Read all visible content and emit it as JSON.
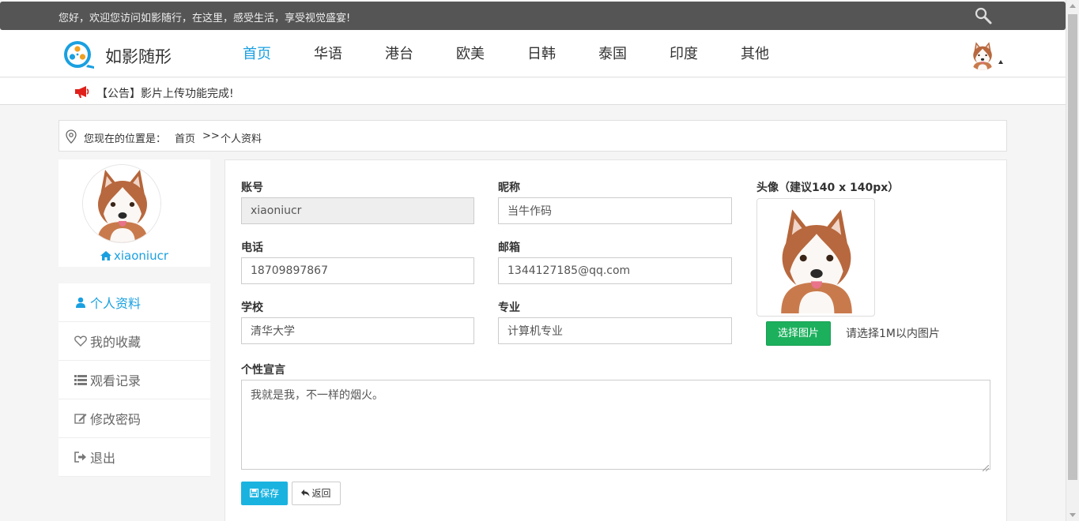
{
  "topbar": {
    "welcome": "您好，欢迎您访问如影随行，在这里，感受生活，享受视觉盛宴!",
    "search_icon": "search-icon"
  },
  "header": {
    "brand": "如影随形",
    "nav": [
      "首页",
      "华语",
      "港台",
      "欧美",
      "日韩",
      "泰国",
      "印度",
      "其他"
    ],
    "active_nav": "首页",
    "accent_color": "#1aa0e0"
  },
  "notice": {
    "text": "【公告】影片上传功能完成!",
    "icon": "megaphone-icon",
    "icon_color": "#e0201a"
  },
  "breadcrumb": {
    "label": "您现在的位置是：",
    "home": "首页",
    "separator": ">>",
    "current": "个人资料"
  },
  "profile": {
    "username": "xiaoniucr"
  },
  "menu": [
    {
      "label": "个人资料",
      "icon": "user-icon"
    },
    {
      "label": "我的收藏",
      "icon": "heart-icon"
    },
    {
      "label": "观看记录",
      "icon": "list-icon"
    },
    {
      "label": "修改密码",
      "icon": "edit-icon"
    },
    {
      "label": "退出",
      "icon": "sign-out-icon"
    }
  ],
  "form": {
    "account": {
      "label": "账号",
      "value": "xiaoniucr"
    },
    "nickname": {
      "label": "昵称",
      "value": "当牛作码"
    },
    "phone": {
      "label": "电话",
      "value": "18709897867"
    },
    "email": {
      "label": "邮箱",
      "value": "1344127185@qq.com"
    },
    "school": {
      "label": "学校",
      "value": "清华大学"
    },
    "major": {
      "label": "专业",
      "value": "计算机专业"
    },
    "motto": {
      "label": "个性宣言",
      "value": "我就是我，不一样的烟火。"
    },
    "avatar": {
      "label": "头像（建议140 x 140px）",
      "choose_button": "选择图片",
      "hint": "请选择1M以内图片"
    },
    "save_button": "保存",
    "back_button": "返回"
  },
  "colors": {
    "primary": "#1ab3e0",
    "success": "#1cb05d",
    "topbar_bg": "#555555"
  }
}
